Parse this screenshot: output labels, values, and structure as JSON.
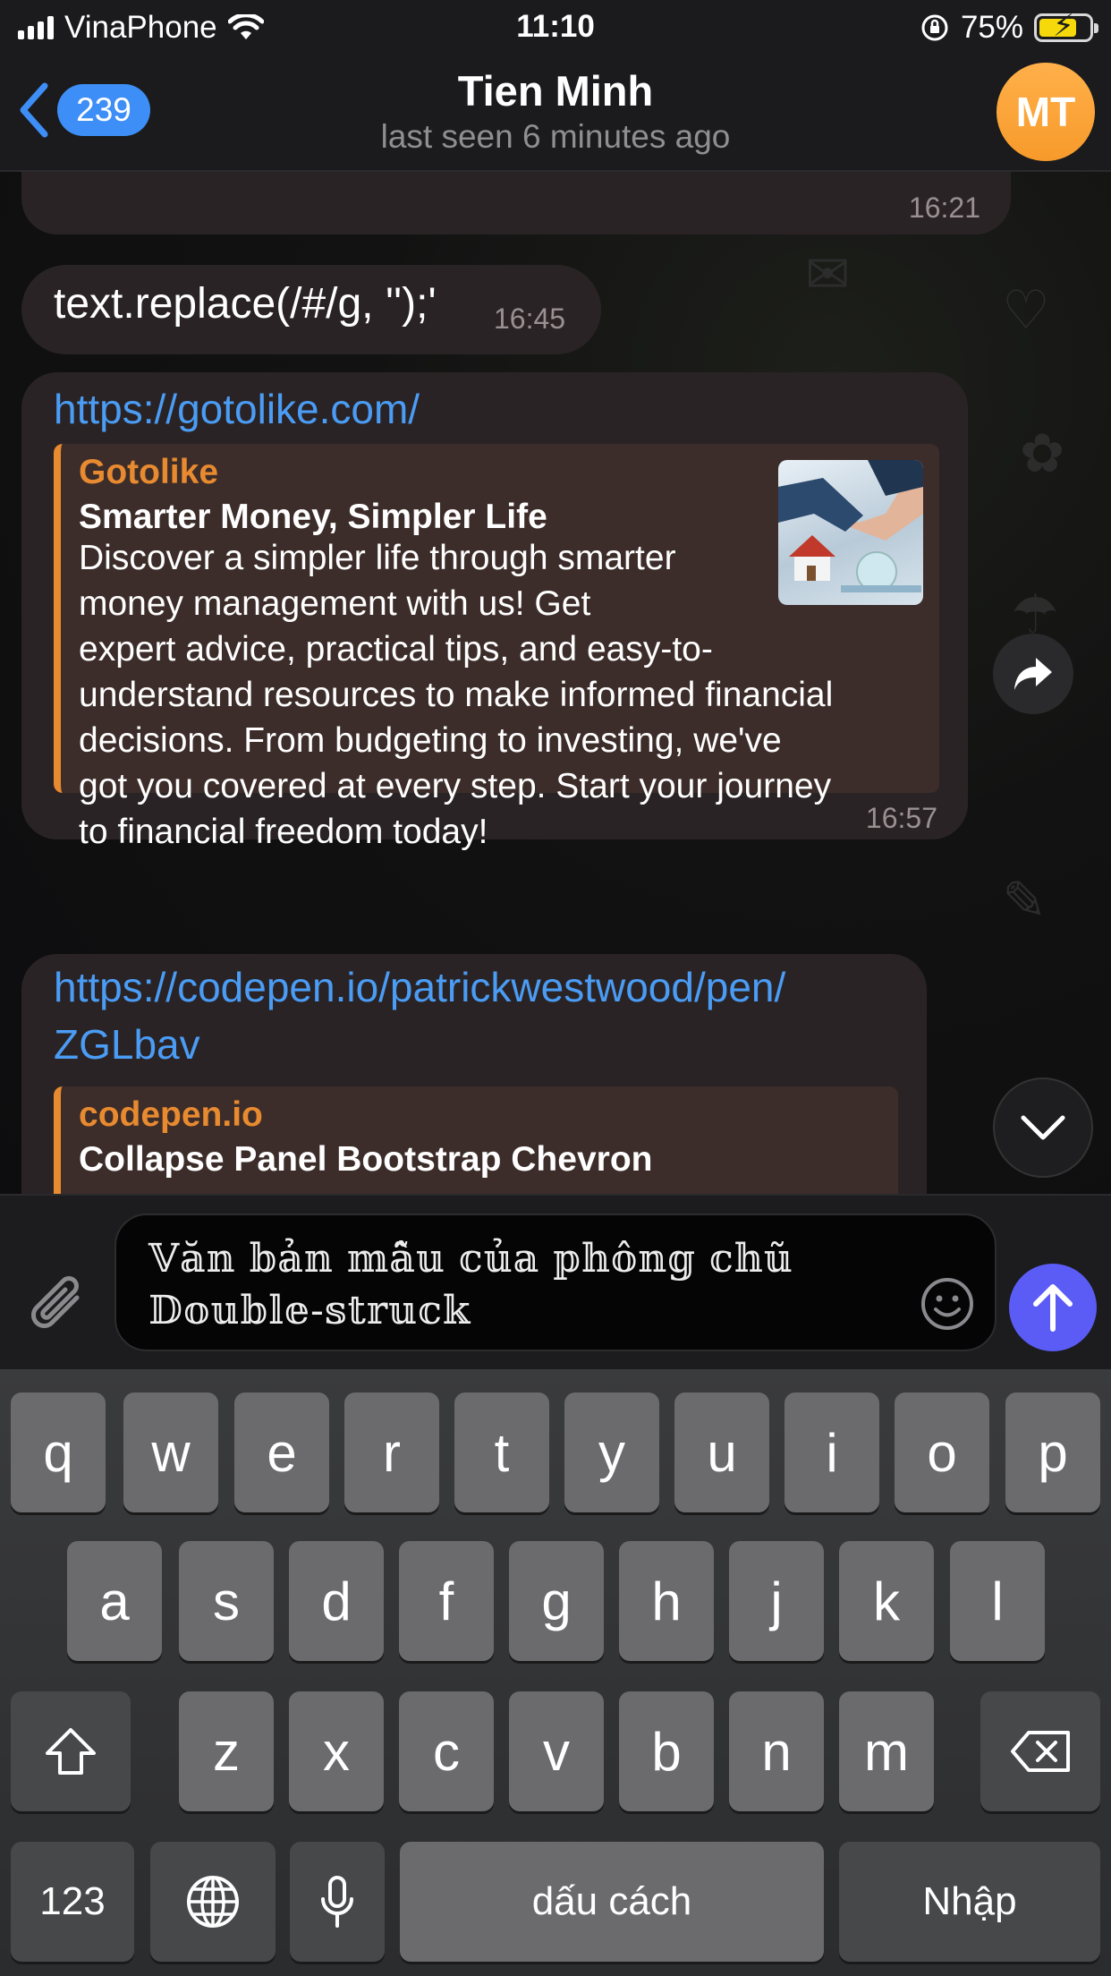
{
  "status_bar": {
    "carrier": "VinaPhone",
    "time": "11:10",
    "battery_percent": "75%",
    "battery_level": 0.75,
    "battery_color": "#f5d90a"
  },
  "header": {
    "back_count": "239",
    "title": "Tien Minh",
    "subtitle": "last seen 6 minutes ago",
    "avatar_initials": "MT",
    "avatar_color": "#f79a2b"
  },
  "messages": [
    {
      "time": "16:21"
    },
    {
      "text": "text.replace(/#/g, '');'",
      "time": "16:45"
    },
    {
      "link": "https://gotolike.com/",
      "preview": {
        "site": "Gotolike",
        "title": "Smarter Money, Simpler Life",
        "description_lines": [
          "Discover a simpler life through smarter",
          "money management with us! Get",
          "expert advice, practical tips, and easy-to-",
          "understand resources to make informed financial",
          "decisions. From budgeting to investing, we've",
          "got you covered at every step. Start your journey",
          "to financial freedom today!"
        ]
      },
      "time": "16:57"
    },
    {
      "link_lines": [
        "https://codepen.io/patrickwestwood/pen/",
        "ZGLbav"
      ],
      "preview": {
        "site": "codepen.io",
        "title": "Collapse Panel Bootstrap Chevron"
      }
    }
  ],
  "composer": {
    "text": "𝕍𝕒̆𝕟 𝕓𝕒̉𝕟 𝕞𝕒̂̃𝕦 𝕔𝕦̉𝕒 𝕡𝕙𝕠̂𝕟𝕘 𝕔𝕙𝕦̃\n𝔻𝕠𝕦𝕓𝕝𝕖-𝕤𝕥𝕣𝕦𝕔𝕜",
    "send_color": "#5b5cf6"
  },
  "keyboard": {
    "row1": [
      "q",
      "w",
      "e",
      "r",
      "t",
      "y",
      "u",
      "i",
      "o",
      "p"
    ],
    "row2": [
      "a",
      "s",
      "d",
      "f",
      "g",
      "h",
      "j",
      "k",
      "l"
    ],
    "row3": [
      "z",
      "x",
      "c",
      "v",
      "b",
      "n",
      "m"
    ],
    "numbers_key": "123",
    "space_key": "dấu cách",
    "return_key": "Nhập"
  }
}
